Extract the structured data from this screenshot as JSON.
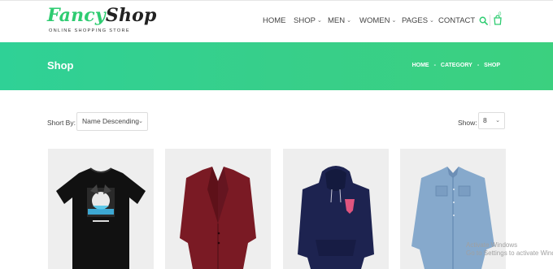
{
  "brand": {
    "name_part1": "Fancy",
    "name_part2": "Shop",
    "tagline": "ONLINE SHOPPING STORE",
    "accent_color": "#2ecc71"
  },
  "nav": {
    "items": [
      {
        "label": "HOME",
        "has_caret": false
      },
      {
        "label": "SHOP",
        "has_caret": true
      },
      {
        "label": "MEN",
        "has_caret": true
      },
      {
        "label": "WOMEN",
        "has_caret": true
      },
      {
        "label": "PAGES",
        "has_caret": true
      },
      {
        "label": "CONTACT",
        "has_caret": false
      }
    ],
    "cart_count": "0",
    "icons": [
      "search-icon",
      "cart-icon"
    ]
  },
  "banner": {
    "title": "Shop",
    "breadcrumb": [
      "HOME",
      "CATEGORY",
      "SHOP"
    ],
    "separator": "-"
  },
  "toolbar": {
    "sort_label": "Short By:",
    "sort_value": "Name Descending",
    "show_label": "Show:",
    "show_value": "8"
  },
  "products": [
    {
      "kind": "black-graphic-tshirt",
      "image_color": "#111111"
    },
    {
      "kind": "maroon-blazer",
      "image_color": "#7a1a24"
    },
    {
      "kind": "navy-hoodie",
      "image_color": "#1d2350"
    },
    {
      "kind": "denim-shirt",
      "image_color": "#7fa3c9"
    }
  ],
  "os_watermark": {
    "line1": "Activate Windows",
    "line2": "Go to Settings to activate Windows."
  }
}
